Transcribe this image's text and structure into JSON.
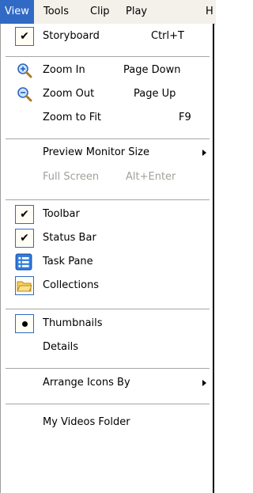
{
  "menubar": {
    "items": [
      "View",
      "Tools",
      "Clip",
      "Play",
      "H"
    ]
  },
  "menu": {
    "storyboard": {
      "label": "Storyboard",
      "shortcut": "Ctrl+T",
      "checked": true
    },
    "zoom_in": {
      "label": "Zoom In",
      "shortcut": "Page Down",
      "icon": "zoom-in-icon"
    },
    "zoom_out": {
      "label": "Zoom Out",
      "shortcut": "Page Up",
      "icon": "zoom-out-icon"
    },
    "zoom_fit": {
      "label": "Zoom to Fit",
      "shortcut": "F9"
    },
    "preview": {
      "label": "Preview Monitor Size"
    },
    "fullscreen": {
      "label": "Full Screen",
      "shortcut": "Alt+Enter"
    },
    "toolbar": {
      "label": "Toolbar",
      "checked": true
    },
    "statusbar": {
      "label": "Status Bar",
      "checked": true
    },
    "taskpane": {
      "label": "Task Pane",
      "icon": "task-pane-icon"
    },
    "collections": {
      "label": "Collections",
      "icon": "folder-icon"
    },
    "thumbnails": {
      "label": "Thumbnails",
      "selected": true
    },
    "details": {
      "label": "Details"
    },
    "arrange": {
      "label": "Arrange Icons By"
    },
    "myvideos": {
      "label": "My Videos Folder"
    }
  },
  "colors": {
    "highlight": "#316ac5",
    "menubar_bg": "#f3f1ea",
    "disabled_text": "#a4a099"
  }
}
